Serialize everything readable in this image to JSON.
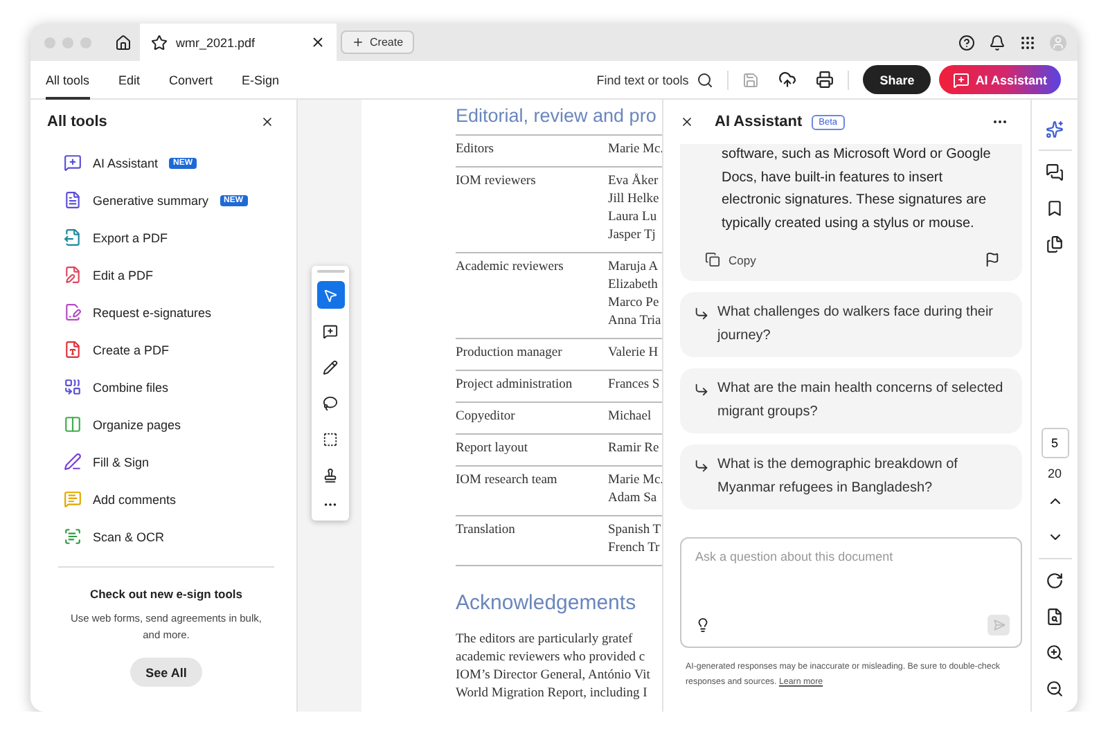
{
  "browser_tab": {
    "title": "wmr_2021.pdf",
    "create_label": "Create"
  },
  "tabs": [
    {
      "label": "All tools",
      "selected": true
    },
    {
      "label": "Edit",
      "selected": false
    },
    {
      "label": "Convert",
      "selected": false
    },
    {
      "label": "E-Sign",
      "selected": false
    }
  ],
  "toolbar": {
    "search_label": "Find text or tools",
    "share_label": "Share",
    "ai_label": "AI Assistant"
  },
  "tools_panel": {
    "title": "All tools",
    "items": [
      {
        "label": "AI Assistant",
        "badge": "NEW"
      },
      {
        "label": "Generative summary",
        "badge": "NEW"
      },
      {
        "label": "Export a PDF"
      },
      {
        "label": "Edit a PDF"
      },
      {
        "label": "Request e-signatures"
      },
      {
        "label": "Create a PDF"
      },
      {
        "label": "Combine files"
      },
      {
        "label": "Organize pages"
      },
      {
        "label": "Fill & Sign"
      },
      {
        "label": "Add comments"
      },
      {
        "label": "Scan & OCR"
      }
    ],
    "promo": {
      "title": "Check out new e-sign tools",
      "text": "Use web forms, send agreements in bulk, and more.",
      "button": "See All"
    }
  },
  "annotation_tools": [
    {
      "selected": true
    },
    {
      "selected": false
    },
    {
      "selected": false
    },
    {
      "selected": false
    },
    {
      "selected": false
    },
    {
      "selected": false
    }
  ],
  "document": {
    "heading": "Editorial, review and pro",
    "rows": [
      {
        "role": "Editors",
        "names": [
          "Marie Mc."
        ]
      },
      {
        "role": "IOM reviewers",
        "names": [
          "Eva Åker",
          "Jill Helke",
          "Laura Lu",
          "Jasper Tj"
        ]
      },
      {
        "role": "Academic reviewers",
        "names": [
          "Maruja A",
          "Elizabeth",
          "Marco Pe",
          "Anna Tria"
        ]
      },
      {
        "role": "Production manager",
        "names": [
          "Valerie H"
        ]
      },
      {
        "role": "Project administration",
        "names": [
          "Frances S"
        ]
      },
      {
        "role": "Copyeditor",
        "names": [
          "Michael"
        ]
      },
      {
        "role": "Report layout",
        "names": [
          "Ramir Re"
        ]
      },
      {
        "role": "IOM research team",
        "names": [
          "Marie Mc.",
          "Adam Sa"
        ]
      },
      {
        "role": "Translation",
        "names": [
          "Spanish T",
          "French Tr"
        ]
      }
    ],
    "section_heading": "Acknowledgements",
    "paragraph_lines": [
      "The editors are particularly gratef",
      "academic reviewers who provided c",
      "IOM’s Director General, António Vit",
      "World Migration Report, including I"
    ]
  },
  "ai_panel": {
    "title": "AI Assistant",
    "badge": "Beta",
    "answer": "software, such as Microsoft Word or Google Docs, have built-in features to insert electronic signatures. These signatures are typically created using a stylus or mouse.",
    "copy_label": "Copy",
    "suggestions": [
      "What challenges do walkers face during their journey?",
      "What are the main health concerns of selected migrant groups?",
      "What is the demographic breakdown of Myanmar refugees in Bangladesh?"
    ],
    "input": {
      "placeholder": "Ask a question about this document"
    },
    "disclaimer": "AI-generated responses may be inaccurate or misleading. Be sure to double-check responses and sources.",
    "learn_more": "Learn more"
  },
  "page_nav": {
    "current": "5",
    "total": "20"
  }
}
